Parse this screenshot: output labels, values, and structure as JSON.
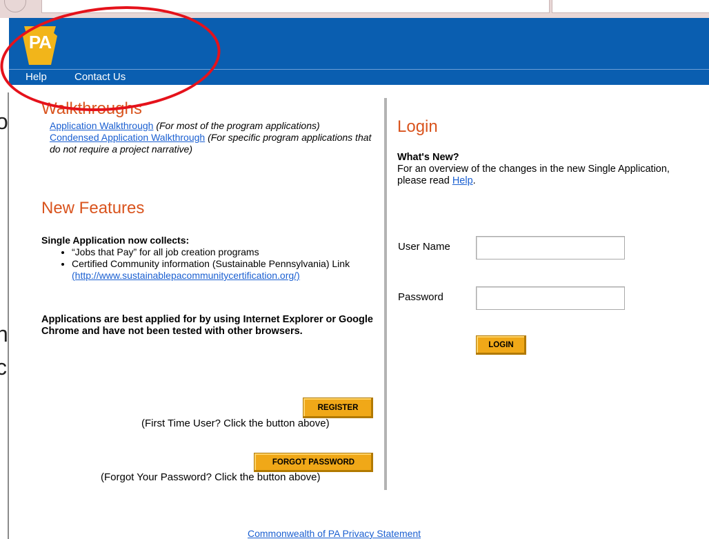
{
  "header": {
    "logo_text": "PA",
    "nav": {
      "help": "Help",
      "contact": "Contact Us"
    }
  },
  "walkthroughs": {
    "title": "Walkthroughs",
    "link1": "Application Walkthrough",
    "note1": "(For most of the program applications)",
    "link2": "Condensed Application Walkthrough",
    "note2": "(For specific program applications that do not require a project narrative)"
  },
  "new_features": {
    "title": "New Features",
    "intro": "Single Application now collects:",
    "bullet1": "“Jobs that Pay” for all job creation programs",
    "bullet2": "Certified Community information (Sustainable Pennsylvania) Link",
    "bullet2_link": "(http://www.sustainablepacommunitycertification.org/)",
    "browser_note": "Applications are best applied for by using Internet Explorer or Google Chrome and have not been tested with other browsers."
  },
  "register": {
    "button": "REGISTER",
    "hint": "(First Time User? Click the button above)"
  },
  "forgot": {
    "button": "FORGOT PASSWORD",
    "hint": "(Forgot Your Password? Click the button above)"
  },
  "login": {
    "title": "Login",
    "whats_new_title": "What's New?",
    "whats_new_text": "For an overview of the changes in the new Single Application, please read",
    "whats_new_link": "Help",
    "whats_new_end": ".",
    "username_label": "User Name",
    "username_value": "",
    "password_label": "Password",
    "password_value": "",
    "button": "LOGIN"
  },
  "footer": {
    "privacy": "Commonwealth of PA Privacy Statement"
  },
  "colors": {
    "header_blue": "#0a5eb0",
    "heading_orange": "#d9541e",
    "button_gold": "#f0a818",
    "link_blue": "#1a5fd1",
    "annotation_red": "#e5121b"
  }
}
